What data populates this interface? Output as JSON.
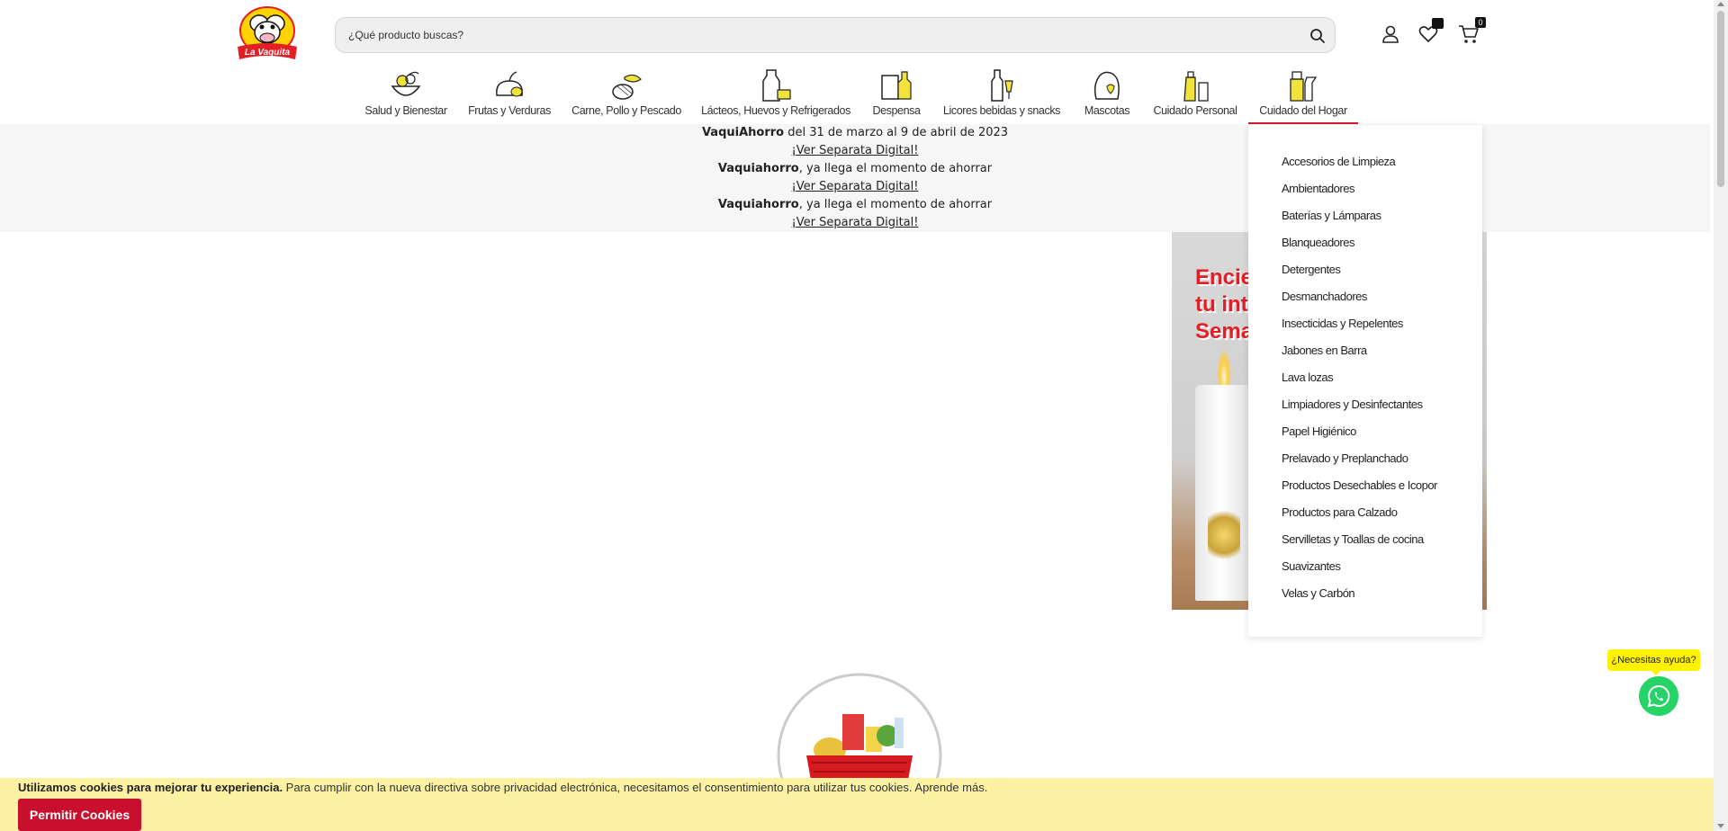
{
  "header": {
    "logo_text": "La Vaquita",
    "search_placeholder": "¿Qué producto buscas?",
    "cart_count": "0",
    "icons": [
      "user-icon",
      "heart-icon",
      "cart-icon",
      "search-icon"
    ]
  },
  "categories": [
    {
      "label": "Salud y Bienestar",
      "icon": "salad-bowl-icon"
    },
    {
      "label": "Frutas y Verduras",
      "icon": "fruit-icon"
    },
    {
      "label": "Carne, Pollo y Pescado",
      "icon": "meat-fish-icon"
    },
    {
      "label": "Lácteos, Huevos y Refrigerados",
      "icon": "milk-cheese-icon"
    },
    {
      "label": "Despensa",
      "icon": "pantry-icon"
    },
    {
      "label": "Licores bebidas y snacks",
      "icon": "bottles-icon"
    },
    {
      "label": "Mascotas",
      "icon": "pet-icon"
    },
    {
      "label": "Cuidado Personal",
      "icon": "personal-care-icon"
    },
    {
      "label": "Cuidado del Hogar",
      "icon": "home-care-icon"
    }
  ],
  "promo": {
    "line1_bold": "VaquiAhorro",
    "line1_rest": " del 31 de marzo al 9 de abril de 2023",
    "link": "¡Ver Separata Digital!",
    "line2_bold": "Vaquiahorro",
    "line2_rest": ", ya llega el momento de ahorrar"
  },
  "banner": {
    "text_lines": [
      "Encie",
      "tu int",
      "Sema"
    ]
  },
  "dropdown": {
    "items": [
      "Accesorios de Limpieza",
      "Ambientadores",
      "Baterías y Lámparas",
      "Blanqueadores",
      "Detergentes",
      "Desmanchadores",
      "Insecticidas y Repelentes",
      "Jabones en Barra",
      "Lava lozas",
      "Limpiadores y Desinfectantes",
      "Papel Higiénico",
      "Prelavado y Preplanchado",
      "Productos Desechables e Icopor",
      "Productos para Calzado",
      "Servilletas y Toallas de cocina",
      "Suavizantes",
      "Velas y Carbón"
    ]
  },
  "whatsapp": {
    "help_text": "¿Necesitas ayuda?"
  },
  "cookies": {
    "bold": "Utilizamos cookies para mejorar tu experiencia.",
    "text": " Para cumplir con la nueva directiva sobre privacidad electrónica, necesitamos el consentimiento para utilizar tus cookies. ",
    "learn_more": "Aprende más.",
    "button": "Permitir Cookies"
  },
  "colors": {
    "brand_red": "#c8102e",
    "brand_yellow": "#fff200",
    "cookie_bar": "#fdf1a3",
    "whatsapp_green": "#25d366"
  }
}
